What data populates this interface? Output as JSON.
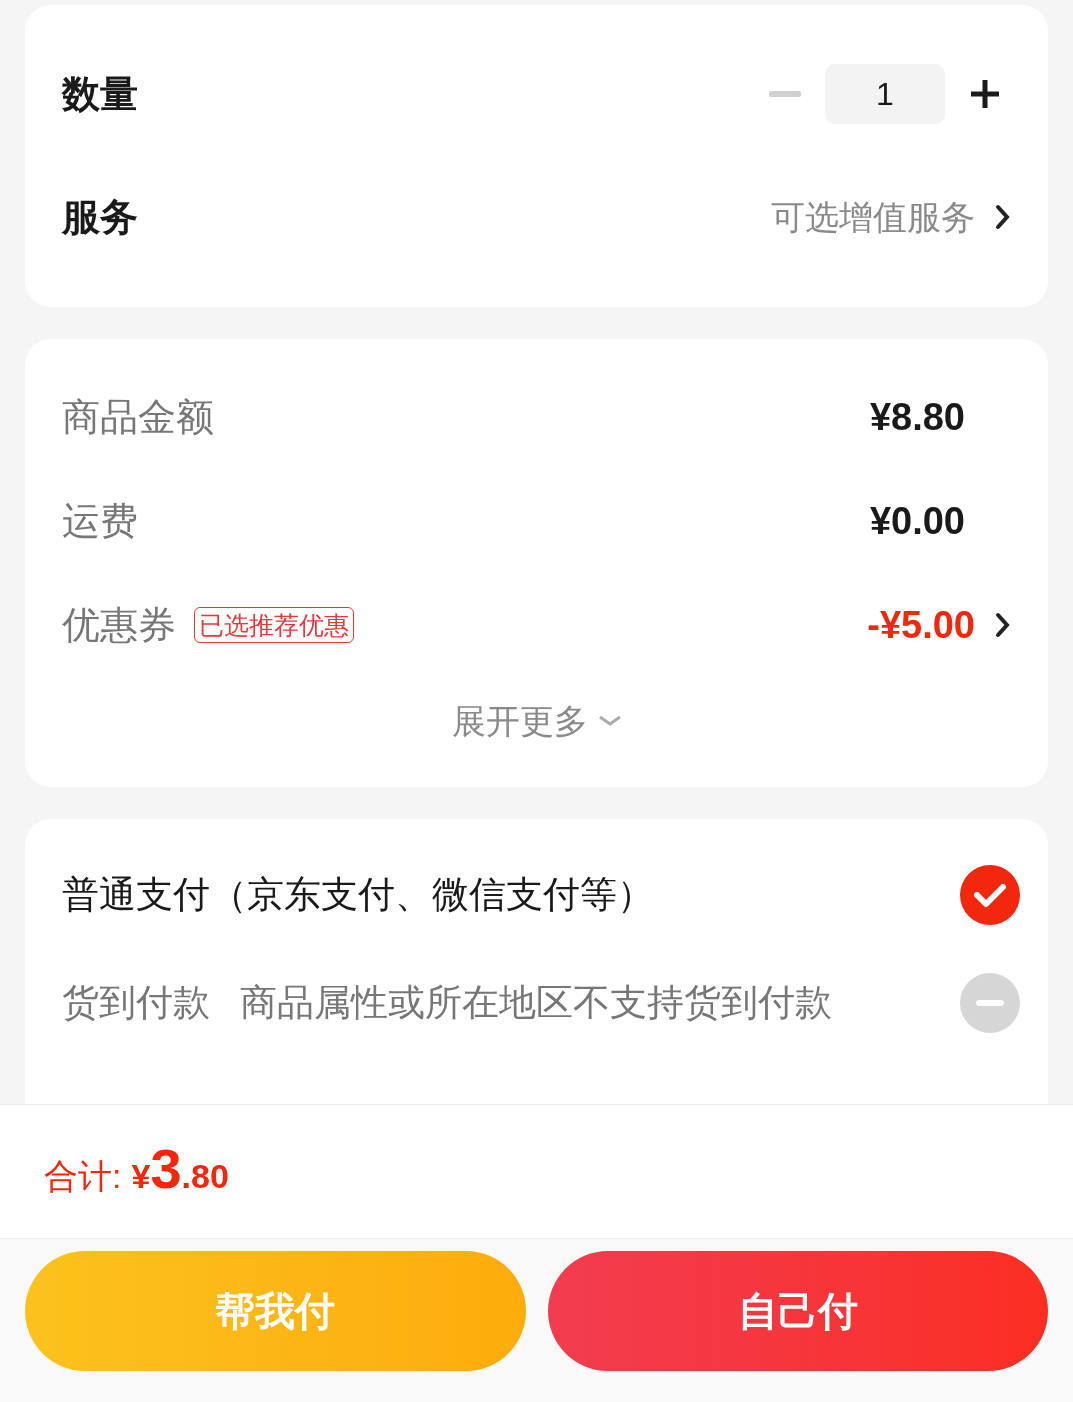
{
  "options": {
    "quantity": {
      "label": "数量",
      "value": "1",
      "decrement_disabled": true
    },
    "service": {
      "label": "服务",
      "value": "可选增值服务"
    }
  },
  "price": {
    "rows": [
      {
        "label": "商品金额",
        "value": "¥8.80",
        "highlight": false,
        "has_arrow": false
      },
      {
        "label": "运费",
        "value": "¥0.00",
        "highlight": false,
        "has_arrow": false
      },
      {
        "label": "优惠券",
        "tag": "已选推荐优惠",
        "value": "-¥5.00",
        "highlight": true,
        "has_arrow": true
      }
    ],
    "expand": "展开更多"
  },
  "payment": {
    "methods": [
      {
        "label": "普通支付（京东支付、微信支付等）",
        "selected": true,
        "disabled": false
      },
      {
        "label": "货到付款",
        "note": "商品属性或所在地区不支持货到付款",
        "selected": false,
        "disabled": true
      }
    ]
  },
  "footer": {
    "total_label": "合计:",
    "currency": "¥",
    "total_int": "3",
    "total_dec": ".80",
    "buttons": [
      {
        "label": "帮我付",
        "kind": "friend"
      },
      {
        "label": "自己付",
        "kind": "self"
      }
    ]
  }
}
